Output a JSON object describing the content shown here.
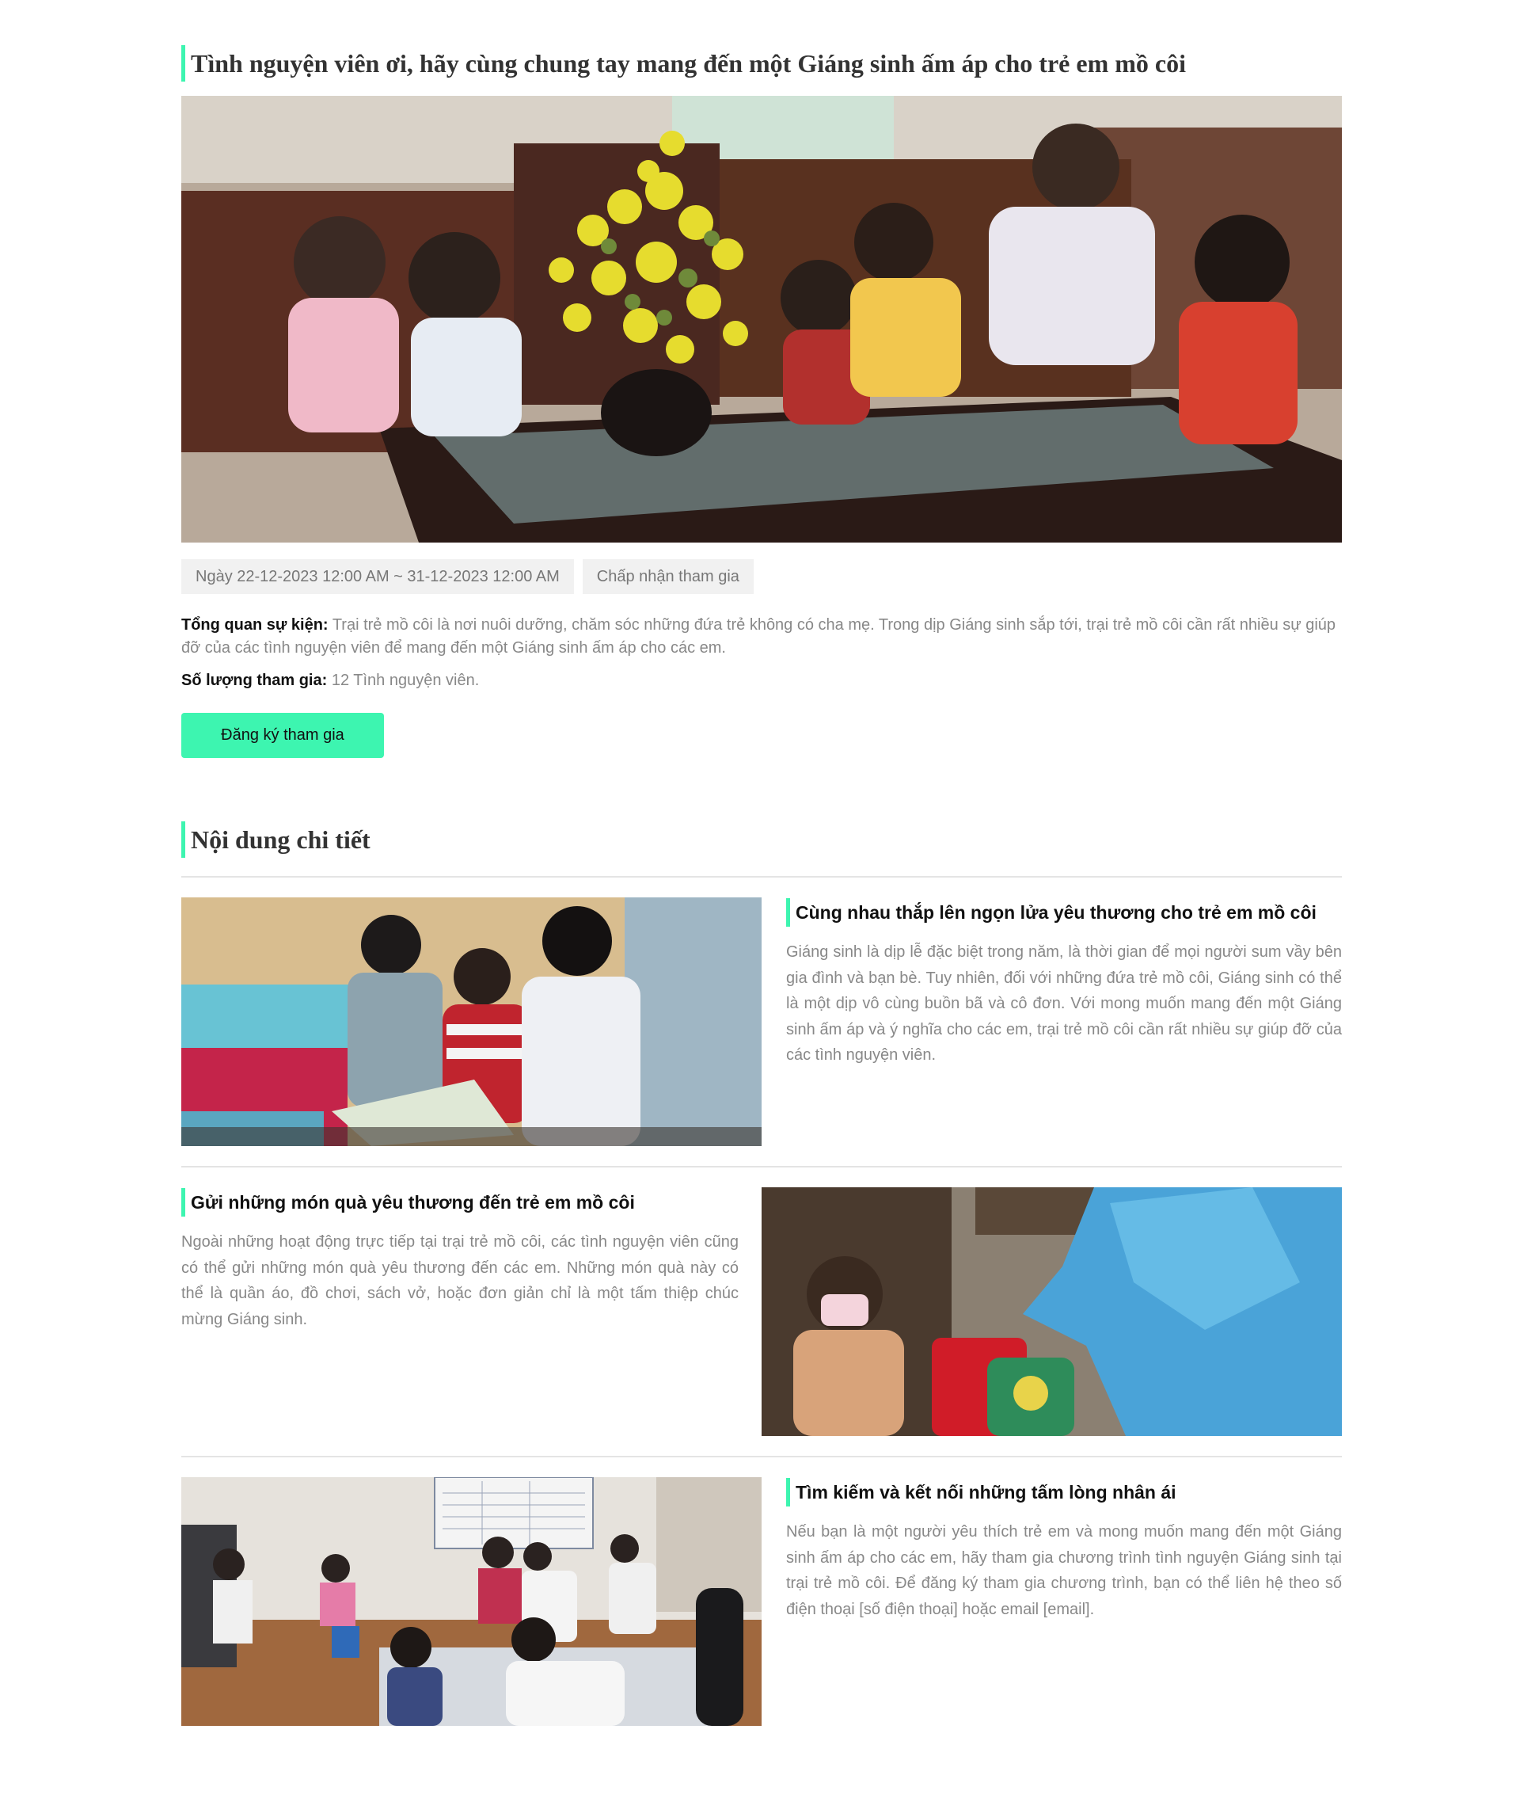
{
  "event": {
    "title": "Tình nguyện viên ơi, hãy cùng chung tay mang đến một Giáng sinh ấm áp cho trẻ em mồ côi",
    "date_range": "Ngày 22-12-2023 12:00 AM ~ 31-12-2023 12:00 AM",
    "status": "Chấp nhận tham gia",
    "overview_label": "Tổng quan sự kiện:",
    "overview_text": "Trại trẻ mồ côi là nơi nuôi dưỡng, chăm sóc những đứa trẻ không có cha mẹ. Trong dịp Giáng sinh sắp tới, trại trẻ mồ côi cần rất nhiều sự giúp đỡ của các tình nguyện viên để mang đến một Giáng sinh ấm áp cho các em.",
    "count_label": "Số lượng tham gia:",
    "count_text": "12 Tình nguyện viên.",
    "register_label": "Đăng ký tham gia"
  },
  "details": {
    "section_title": "Nội dung chi tiết",
    "blocks": [
      {
        "heading": "Cùng nhau thắp lên ngọn lửa yêu thương cho trẻ em mồ côi",
        "body": "Giáng sinh là dịp lễ đặc biệt trong năm, là thời gian để mọi người sum vầy bên gia đình và bạn bè. Tuy nhiên, đối với những đứa trẻ mồ côi, Giáng sinh có thể là một dịp vô cùng buồn bã và cô đơn. Với mong muốn mang đến một Giáng sinh ấm áp và ý nghĩa cho các em, trại trẻ mồ côi cần rất nhiều sự giúp đỡ của các tình nguyện viên."
      },
      {
        "heading": "Gửi những món quà yêu thương đến trẻ em mồ côi",
        "body": "Ngoài những hoạt động trực tiếp tại trại trẻ mồ côi, các tình nguyện viên cũng có thể gửi những món quà yêu thương đến các em. Những món quà này có thể là quần áo, đồ chơi, sách vở, hoặc đơn giản chỉ là một tấm thiệp chúc mừng Giáng sinh."
      },
      {
        "heading": "Tìm kiếm và kết nối những tấm lòng nhân ái",
        "body": "Nếu bạn là một người yêu thích trẻ em và mong muốn mang đến một Giáng sinh ấm áp cho các em, hãy tham gia chương trình tình nguyện Giáng sinh tại trại trẻ mồ côi. Để đăng ký tham gia chương trình, bạn có thể liên hệ theo số điện thoại [số điện thoại] hoặc email [email]."
      }
    ]
  },
  "colors": {
    "accent": "#3df5b0",
    "tag_background": "#f1f1f1",
    "muted_text": "#888888",
    "divider": "#e4e4e4"
  }
}
